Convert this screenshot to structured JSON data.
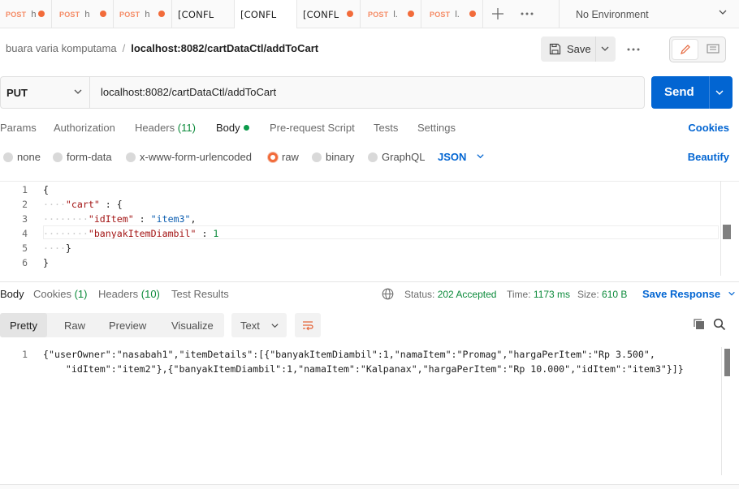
{
  "tabs": [
    {
      "method": "POST",
      "name": "h",
      "dirty": true
    },
    {
      "method": "POST",
      "name": "h",
      "dirty": true
    },
    {
      "method": "POST",
      "name": "h",
      "dirty": true
    },
    {
      "method": "[CONFL",
      "name": "",
      "dirty": false
    },
    {
      "method": "[CONFL",
      "name": "",
      "dirty": false,
      "active": true
    },
    {
      "method": "[CONFL",
      "name": "",
      "dirty": true
    },
    {
      "method": "POST",
      "name": "l.",
      "dirty": true
    },
    {
      "method": "POST",
      "name": "l.",
      "dirty": true
    }
  ],
  "environment": "No Environment",
  "breadcrumb": {
    "collection": "buara varia komputama",
    "separator": "/",
    "request": "localhost:8082/cartDataCtl/addToCart"
  },
  "toolbar": {
    "save_label": "Save"
  },
  "request": {
    "method": "PUT",
    "url": "localhost:8082/cartDataCtl/addToCart",
    "send_label": "Send"
  },
  "request_tabs": {
    "params": "Params",
    "authorization": "Authorization",
    "headers": "Headers",
    "headers_count": "(11)",
    "body": "Body",
    "prerequest": "Pre-request Script",
    "tests": "Tests",
    "settings": "Settings",
    "cookies": "Cookies"
  },
  "body_types": {
    "none": "none",
    "form_data": "form-data",
    "urlencoded": "x-www-form-urlencoded",
    "raw": "raw",
    "binary": "binary",
    "graphql": "GraphQL",
    "format": "JSON",
    "beautify": "Beautify",
    "selected": "raw"
  },
  "editor": {
    "line_numbers": [
      "1",
      "2",
      "3",
      "4",
      "5",
      "6"
    ],
    "l1": "{",
    "l2_key": "\"cart\"",
    "l2_rest": " : {",
    "l3_key": "\"idItem\"",
    "l3_sep": " : ",
    "l3_val": "\"item3\"",
    "l3_end": ",",
    "l4_key": "\"banyakItemDiambil\"",
    "l4_sep": " : ",
    "l4_val": "1",
    "l5": "}",
    "l6": "}"
  },
  "response_tabs": {
    "body": "Body",
    "cookies": "Cookies",
    "cookies_count": "(1)",
    "headers": "Headers",
    "headers_count": "(10)",
    "test_results": "Test Results"
  },
  "response_meta": {
    "status_label": "Status:",
    "status_value": "202 Accepted",
    "time_label": "Time:",
    "time_value": "1173 ms",
    "size_label": "Size:",
    "size_value": "610 B",
    "save_response": "Save Response"
  },
  "view_tabs": {
    "pretty": "Pretty",
    "raw": "Raw",
    "preview": "Preview",
    "visualize": "Visualize",
    "format": "Text"
  },
  "response_body": {
    "line_number": "1",
    "line1": "{\"userOwner\":\"nasabah1\",\"itemDetails\":[{\"banyakItemDiambil\":1,\"namaItem\":\"Promag\",\"hargaPerItem\":\"Rp 3.500\",",
    "line2": "    \"idItem\":\"item2\"},{\"banyakItemDiambil\":1,\"namaItem\":\"Kalpanax\",\"hargaPerItem\":\"Rp 10.000\",\"idItem\":\"item3\"}]}"
  },
  "colors": {
    "accent": "#0265d2",
    "method_post": "#f58a64",
    "dirty_dot": "#f26b3a",
    "success": "#0b8a3a"
  }
}
